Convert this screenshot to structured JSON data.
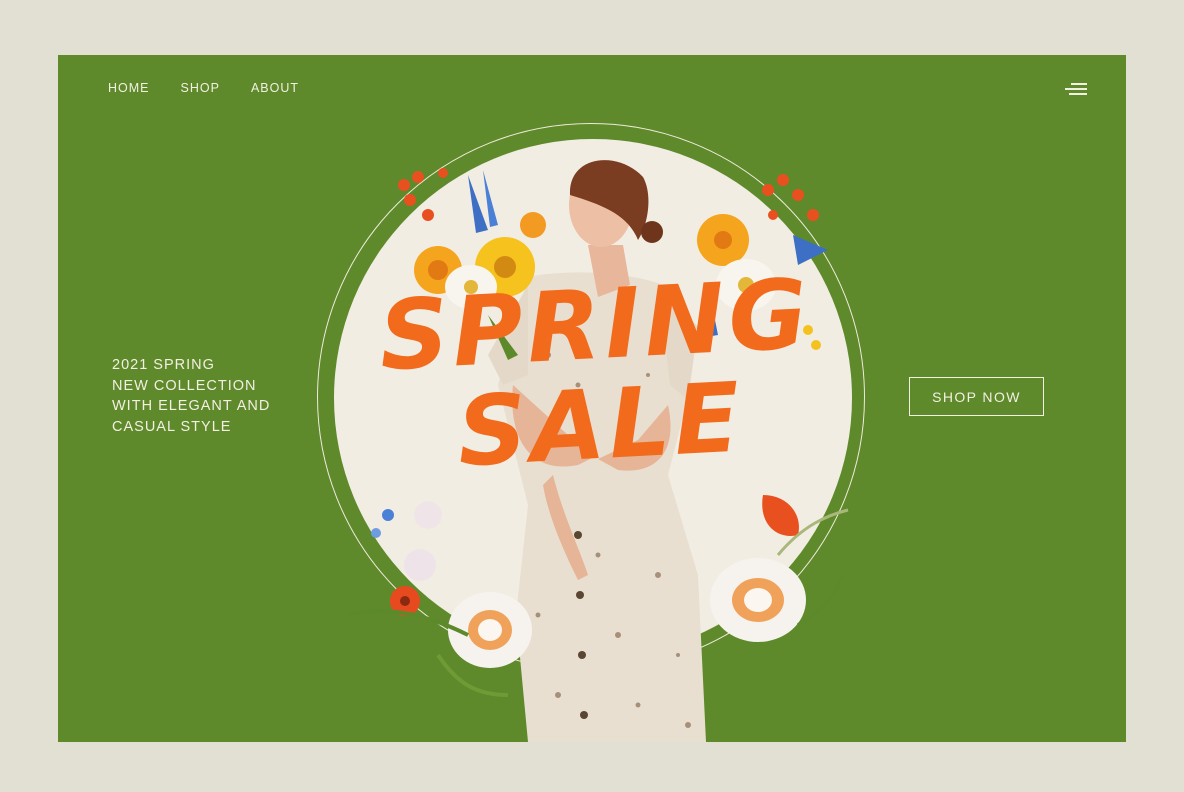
{
  "nav": {
    "items": [
      {
        "label": "HOME"
      },
      {
        "label": "SHOP"
      },
      {
        "label": "ABOUT"
      }
    ]
  },
  "menu": {
    "icon": "hamburger-menu-icon"
  },
  "hero": {
    "tagline": [
      "2021 SPRING",
      "NEW COLLECTION",
      "WITH ELEGANT AND",
      "CASUAL STYLE"
    ],
    "headline": [
      "SPRING",
      "SALE"
    ],
    "cta_label": "SHOP NOW"
  },
  "colors": {
    "background": "#e2e0d2",
    "panel": "#5e8a2b",
    "accent": "#f26a1b",
    "circle": "#f2ede3",
    "text": "#f3efe2"
  }
}
